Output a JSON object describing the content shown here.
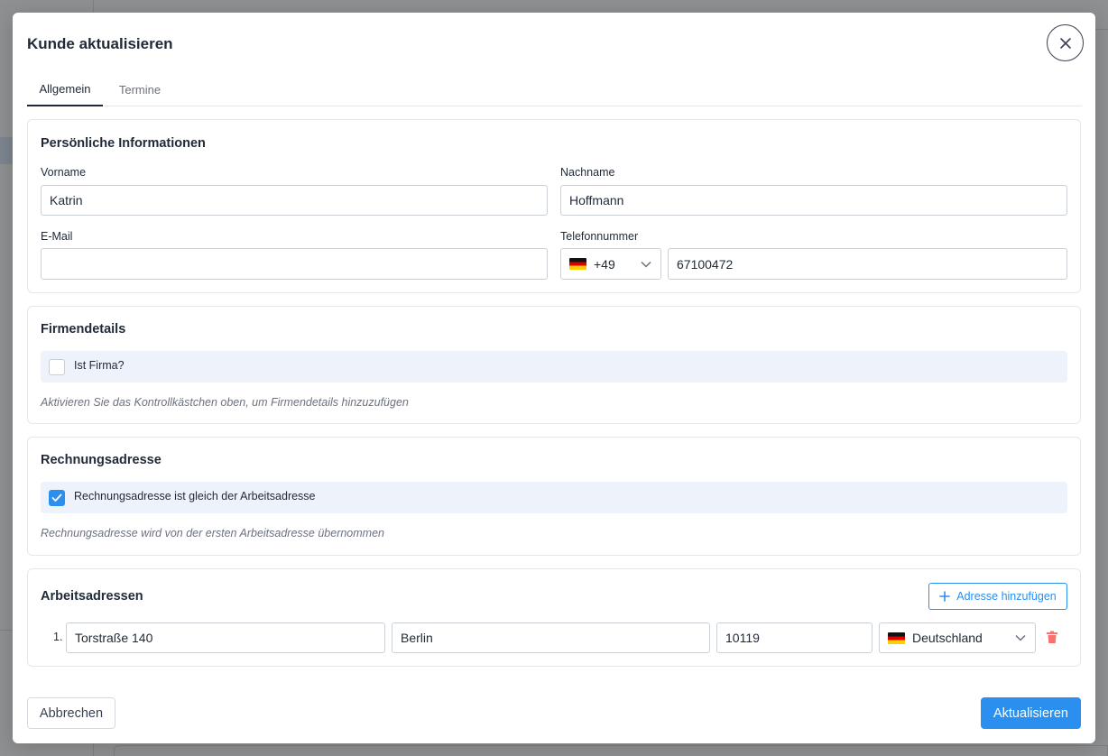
{
  "modal": {
    "title": "Kunde aktualisieren",
    "tabs": [
      {
        "label": "Allgemein",
        "active": true
      },
      {
        "label": "Termine",
        "active": false
      }
    ]
  },
  "personal": {
    "title": "Persönliche Informationen",
    "first_name_label": "Vorname",
    "first_name_value": "Katrin",
    "last_name_label": "Nachname",
    "last_name_value": "Hoffmann",
    "email_label": "E-Mail",
    "email_value": "",
    "phone_label": "Telefonnummer",
    "phone_prefix": "+49",
    "phone_flag": "de-flag-icon",
    "phone_value": "67100472"
  },
  "company": {
    "title": "Firmendetails",
    "checkbox_label": "Ist Firma?",
    "checked": false,
    "hint": "Aktivieren Sie das Kontrollkästchen oben, um Firmendetails hinzuzufügen"
  },
  "billing": {
    "title": "Rechnungsadresse",
    "checkbox_label": "Rechnungsadresse ist gleich der Arbeitsadresse",
    "checked": true,
    "hint": "Rechnungsadresse wird von der ersten Arbeitsadresse übernommen"
  },
  "work_addresses": {
    "title": "Arbeitsadressen",
    "add_label": "Adresse hinzufügen",
    "rows": [
      {
        "number": "1.",
        "street": "Torstraße 140",
        "city": "Berlin",
        "zip": "10119",
        "country": "Deutschland"
      }
    ]
  },
  "footer": {
    "cancel_label": "Abbrechen",
    "update_label": "Aktualisieren"
  },
  "colors": {
    "accent": "#2b8ff0",
    "danger": "#f87171",
    "overlay": "#8f9092",
    "band": "#eef2fa"
  }
}
